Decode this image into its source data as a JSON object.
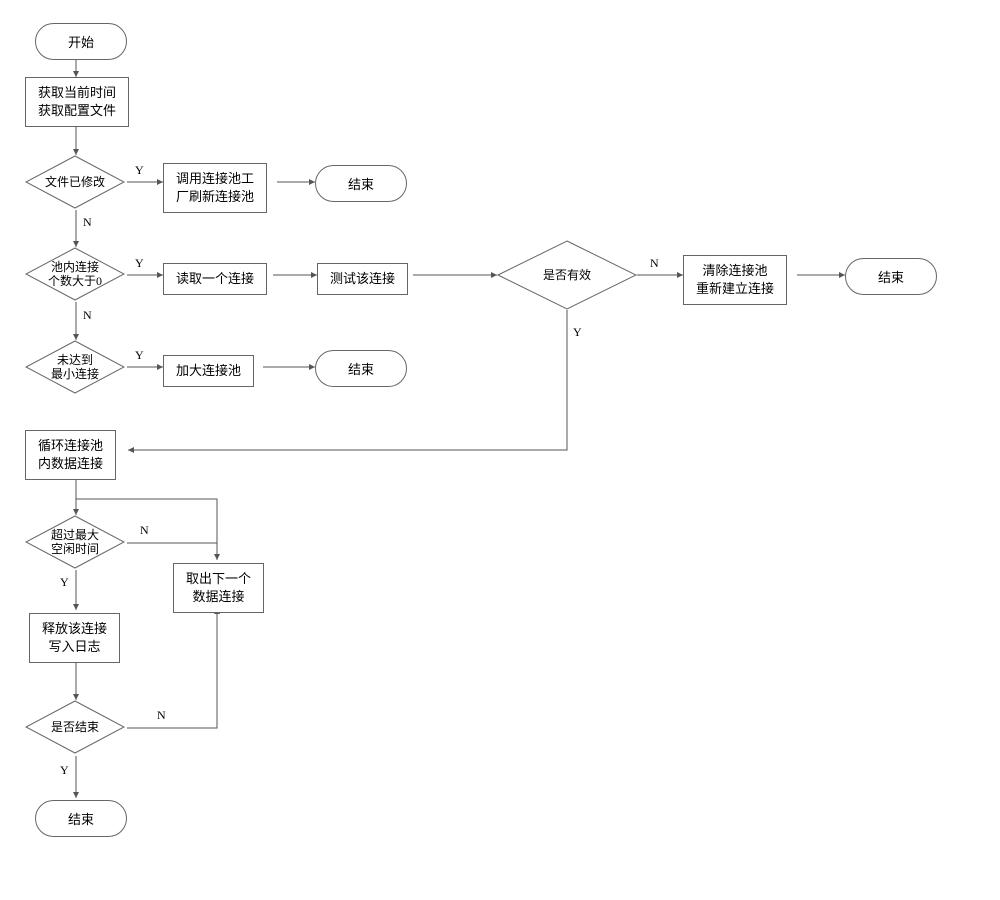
{
  "nodes": {
    "start": "开始",
    "getTimeConfig": "获取当前时间\n获取配置文件",
    "fileModified": "文件已修改",
    "callFactory": "调用连接池工\n厂刷新连接池",
    "end1": "结束",
    "poolCountGt0": "池内连接\n个数大于0",
    "readOne": "读取一个连接",
    "testConn": "测试该连接",
    "isValid": "是否有效",
    "clearRebuild": "清除连接池\n重新建立连接",
    "end2": "结束",
    "notMin": "未达到\n最小连接",
    "enlargePool": "加大连接池",
    "end3": "结束",
    "loopPool": "循环连接池\n内数据连接",
    "exceedIdle": "超过最大\n空闲时间",
    "takeNext": "取出下一个\n数据连接",
    "releaseLog": "释放该连接\n写入日志",
    "isEnd": "是否结束",
    "end4": "结束"
  },
  "labels": {
    "Y": "Y",
    "N": "N"
  }
}
